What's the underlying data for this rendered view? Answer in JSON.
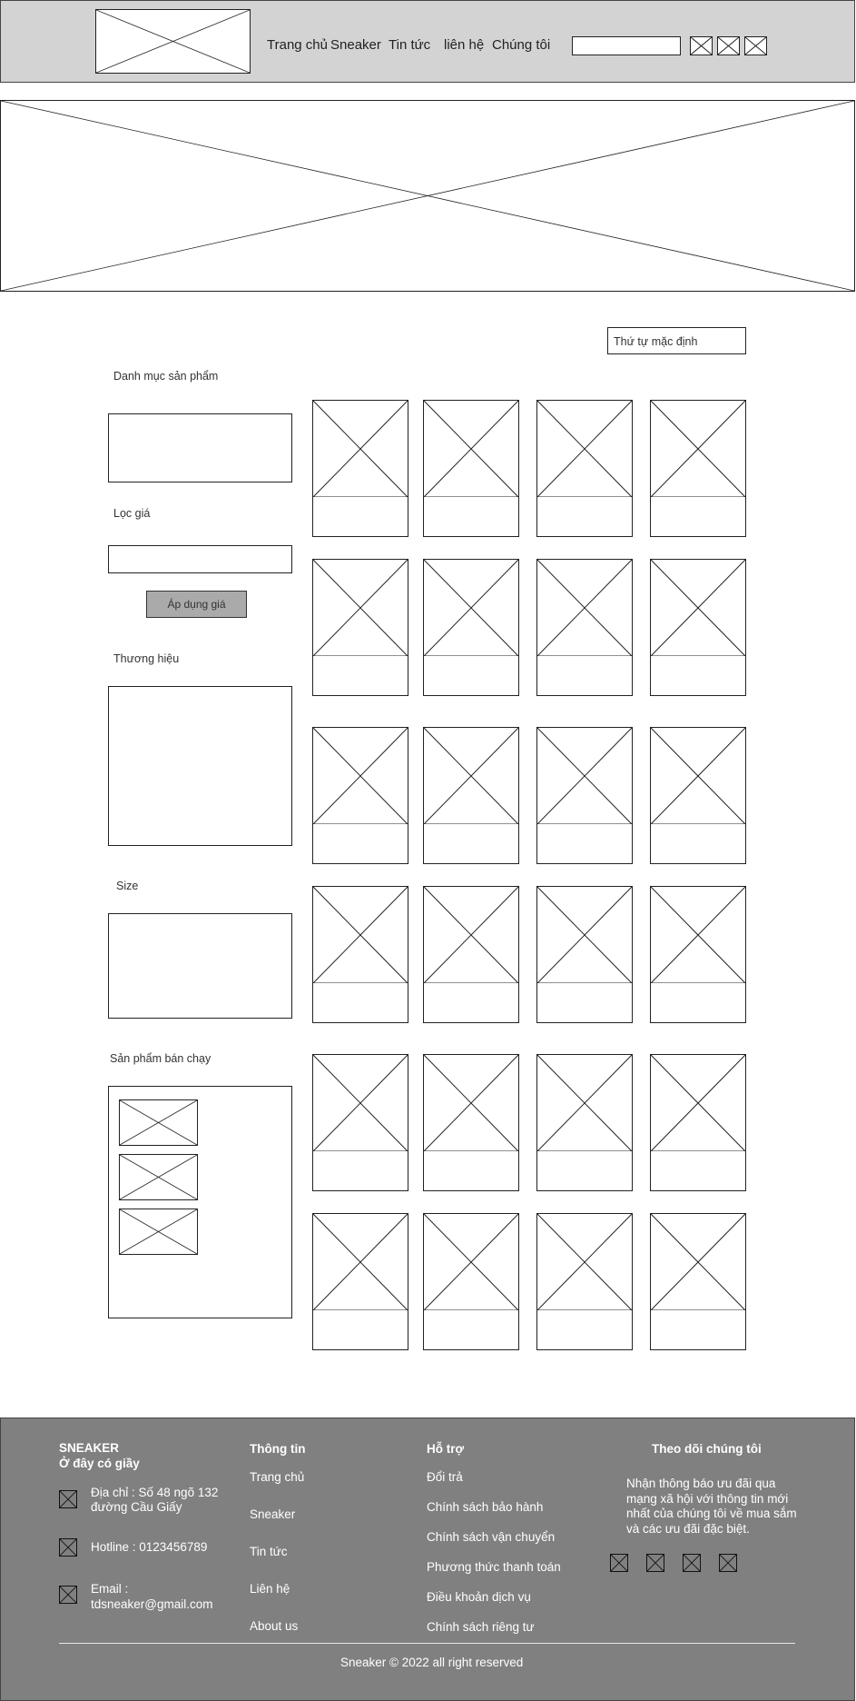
{
  "header": {
    "nav": [
      "Trang chủ",
      "Sneaker",
      "Tin tức",
      "liên hệ",
      "Chúng tôi"
    ],
    "search_value": ""
  },
  "sort": {
    "selected": "Thứ tự mặc định"
  },
  "sidebar": {
    "category_title": "Danh mục sản phẩm",
    "price_title": "Lọc giá",
    "price_value": "",
    "apply_label": "Áp dụng giá",
    "brand_title": "Thương hiệu",
    "size_title": "Size",
    "bestseller_title": "Sản phẩm bán chạy"
  },
  "footer": {
    "brand": "SNEAKER",
    "tagline": "Ở đây có giầy",
    "address_line1": "Địa chỉ : Số 48 ngõ 132",
    "address_line2": "đường Cầu Giấy",
    "hotline": "Hotline : 0123456789",
    "email_label": "Email :",
    "email": "tdsneaker@gmail.com",
    "info_title": "Thông tin",
    "info_links": [
      "Trang chủ",
      "Sneaker",
      "Tin tức",
      "Liên hệ",
      "About us"
    ],
    "support_title": "Hỗ trợ",
    "support_links": [
      "Đổi trả",
      "Chính sách bảo hành",
      "Chính sách vận chuyển",
      "Phương thức thanh toán",
      "Điều khoản dịch vụ",
      "Chính sách riêng tư"
    ],
    "follow_title": "Theo dõi chúng tôi",
    "follow_lines": [
      "Nhận thông báo ưu đãi qua",
      "mạng xã hội với thông tin mới",
      "nhất của chúng tôi về mua sắm",
      "và các ưu đãi đặc biệt."
    ],
    "copyright": "Sneaker © 2022 all right reserved"
  },
  "colors": {
    "header_bg": "#d3d3d3",
    "footer_bg": "#808080",
    "button_bg": "#aaaaaa"
  }
}
